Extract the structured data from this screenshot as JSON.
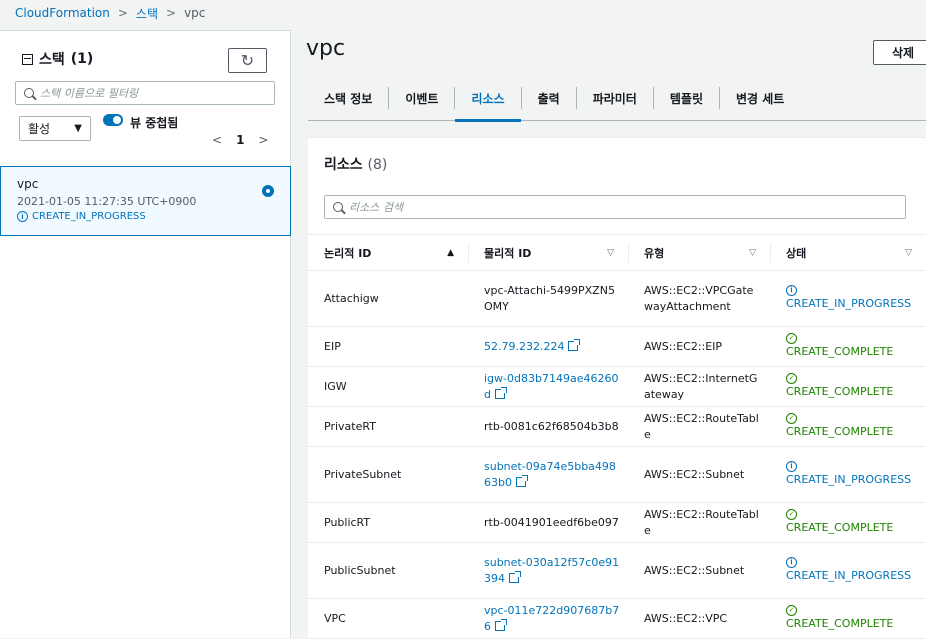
{
  "breadcrumb": [
    "CloudFormation",
    "스택",
    "vpc"
  ],
  "left": {
    "title": "스택",
    "count": "(1)",
    "filter_placeholder": "스택 이름으로 필터링",
    "status_filter": "활성",
    "toggle_label": "뷰 중첩됨",
    "page": "1",
    "stack": {
      "name": "vpc",
      "date": "2021-01-05 11:27:35 UTC+0900",
      "status": "CREATE_IN_PROGRESS"
    }
  },
  "main": {
    "title": "vpc",
    "delete_label": "삭제",
    "tabs": [
      "스택 정보",
      "이벤트",
      "리소스",
      "출력",
      "파라미터",
      "템플릿",
      "변경 세트"
    ],
    "active_tab": "리소스",
    "panel_title": "리소스",
    "panel_count": "(8)",
    "search_placeholder": "리소스 검색",
    "columns": [
      "논리적 ID",
      "물리적 ID",
      "유형",
      "상태"
    ],
    "rows": [
      {
        "logical": "Attachigw",
        "physical": "vpc-Attachi-5499PXZN5OMY",
        "link": false,
        "type": "AWS::EC2::VPCGatewayAttachment",
        "status": "CREATE_IN_PROGRESS",
        "state": "info"
      },
      {
        "logical": "EIP",
        "physical": "52.79.232.224",
        "link": true,
        "type": "AWS::EC2::EIP",
        "status": "CREATE_COMPLETE",
        "state": "ok"
      },
      {
        "logical": "IGW",
        "physical": "igw-0d83b7149ae46260d",
        "link": true,
        "type": "AWS::EC2::InternetGateway",
        "status": "CREATE_COMPLETE",
        "state": "ok"
      },
      {
        "logical": "PrivateRT",
        "physical": "rtb-0081c62f68504b3b8",
        "link": false,
        "type": "AWS::EC2::RouteTable",
        "status": "CREATE_COMPLETE",
        "state": "ok"
      },
      {
        "logical": "PrivateSubnet",
        "physical": "subnet-09a74e5bba49863b0",
        "link": true,
        "type": "AWS::EC2::Subnet",
        "status": "CREATE_IN_PROGRESS",
        "state": "info"
      },
      {
        "logical": "PublicRT",
        "physical": "rtb-0041901eedf6be097",
        "link": false,
        "type": "AWS::EC2::RouteTable",
        "status": "CREATE_COMPLETE",
        "state": "ok"
      },
      {
        "logical": "PublicSubnet",
        "physical": "subnet-030a12f57c0e91394",
        "link": true,
        "type": "AWS::EC2::Subnet",
        "status": "CREATE_IN_PROGRESS",
        "state": "info"
      },
      {
        "logical": "VPC",
        "physical": "vpc-011e722d907687b76",
        "link": true,
        "type": "AWS::EC2::VPC",
        "status": "CREATE_COMPLETE",
        "state": "ok"
      }
    ]
  },
  "colors": {
    "accent": "#0073bb",
    "success": "#1d8102"
  }
}
